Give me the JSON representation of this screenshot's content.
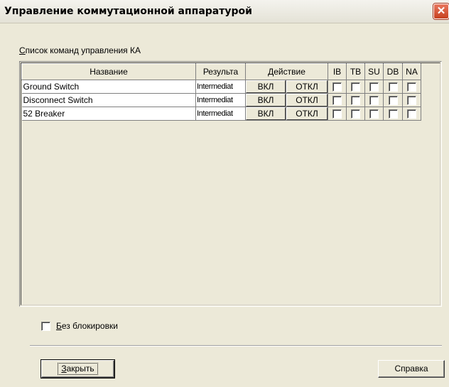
{
  "window": {
    "title": "Управление коммутационной аппаратурой",
    "close_glyph": "✕"
  },
  "list": {
    "caption_first": "С",
    "caption_rest": "писок команд управления КА",
    "columns": {
      "name": "Название",
      "result": "Результа",
      "action": "Действие",
      "ib": "IB",
      "tb": "TB",
      "su": "SU",
      "db": "DB",
      "na": "NA"
    },
    "rows": [
      {
        "name": "Ground Switch",
        "result": "Intermediat",
        "on": "ВКЛ",
        "off": "ОТКЛ"
      },
      {
        "name": "Disconnect Switch",
        "result": "Intermediat",
        "on": "ВКЛ",
        "off": "ОТКЛ"
      },
      {
        "name": "52 Breaker",
        "result": "Intermediat",
        "on": "ВКЛ",
        "off": "ОТКЛ"
      }
    ]
  },
  "no_lock": {
    "label_first": "Б",
    "label_rest": "ез блокировки",
    "checked": false
  },
  "buttons": {
    "close_first": "З",
    "close_rest": "акрыть",
    "help": "Справка"
  },
  "colors": {
    "dialog_bg": "#ece9d8",
    "close_button": "#c6401e"
  }
}
